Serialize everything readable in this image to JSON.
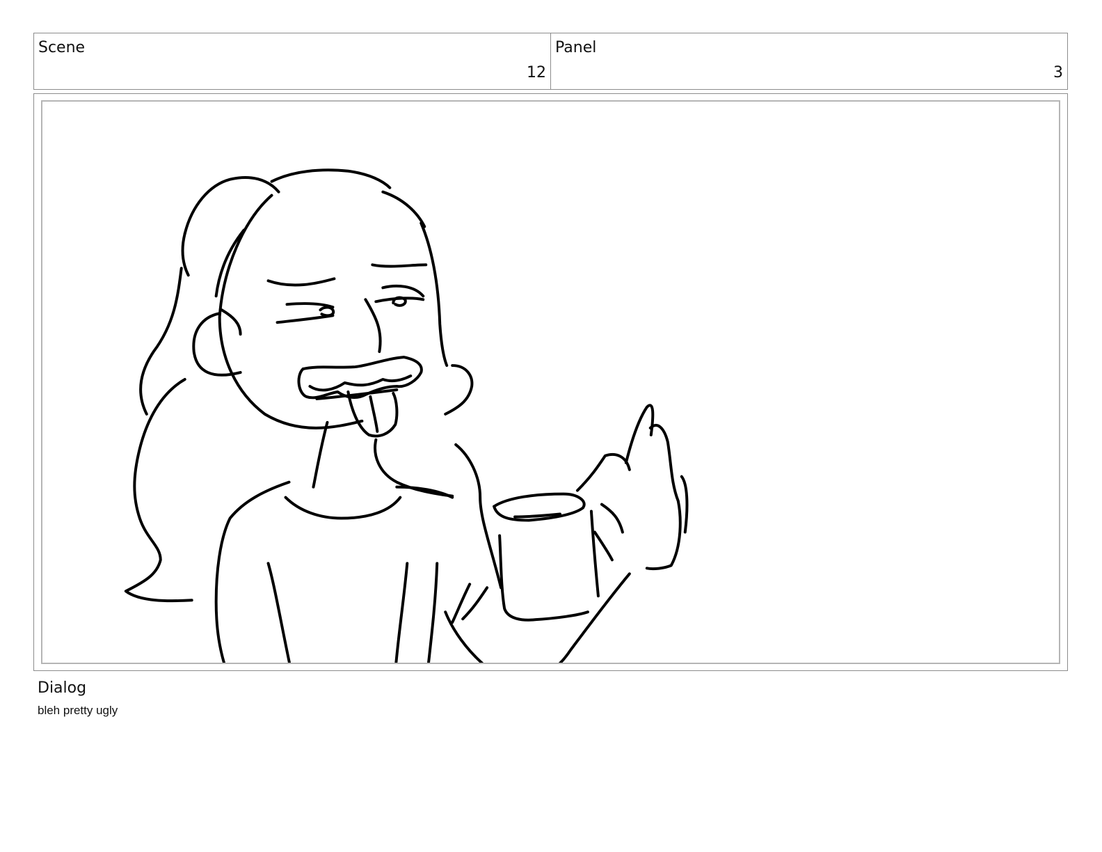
{
  "header": {
    "scene_label": "Scene",
    "scene_value": "12",
    "panel_label": "Panel",
    "panel_value": "3"
  },
  "dialog": {
    "label": "Dialog",
    "text": "bleh pretty ugly"
  },
  "colors": {
    "border": "#8c8c8c",
    "inner_border": "#b5b5b5",
    "ink": "#000000",
    "background": "#ffffff"
  }
}
